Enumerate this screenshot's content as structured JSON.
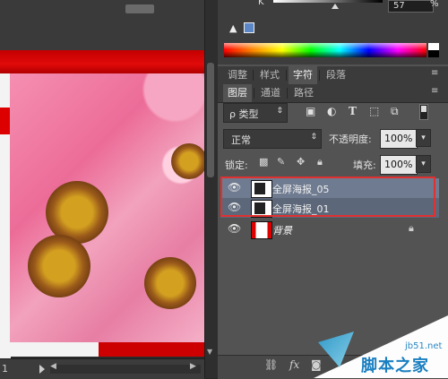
{
  "color_panel": {
    "channel_label": "K",
    "channel_value": "57",
    "channel_unit": "%",
    "warning_icon": "gamut-warning-icon",
    "swatch_color": "#5b86c8"
  },
  "tabs_top": {
    "items": [
      {
        "label": "调整",
        "active": false
      },
      {
        "label": "样式",
        "active": false
      },
      {
        "label": "字符",
        "active": true
      },
      {
        "label": "段落",
        "active": false
      }
    ]
  },
  "tabs_layers": {
    "items": [
      {
        "label": "图层",
        "active": true
      },
      {
        "label": "通道",
        "active": false
      },
      {
        "label": "路径",
        "active": false
      }
    ]
  },
  "layers": {
    "filter_kind": "ρ 类型",
    "filter_icons": [
      "image-filter-icon",
      "adjustment-filter-icon",
      "type-filter-icon",
      "shape-filter-icon",
      "smart-object-filter-icon"
    ],
    "blend_mode": "正常",
    "opacity_label": "不透明度:",
    "opacity_value": "100%",
    "lock_label": "锁定:",
    "fill_label": "填充:",
    "fill_value": "100%",
    "items": [
      {
        "name": "全屏海报_05",
        "visible": true,
        "selected": true
      },
      {
        "name": "全屏海报_01",
        "visible": true,
        "selected": true
      },
      {
        "name": "背景",
        "visible": true,
        "selected": false,
        "locked": true
      }
    ]
  },
  "status_bar": {
    "text": "1"
  },
  "watermark": {
    "url": "jb51.net",
    "text": "脚本之家"
  },
  "colors": {
    "accent_red": "#e03030",
    "panel_bg": "#535353"
  }
}
